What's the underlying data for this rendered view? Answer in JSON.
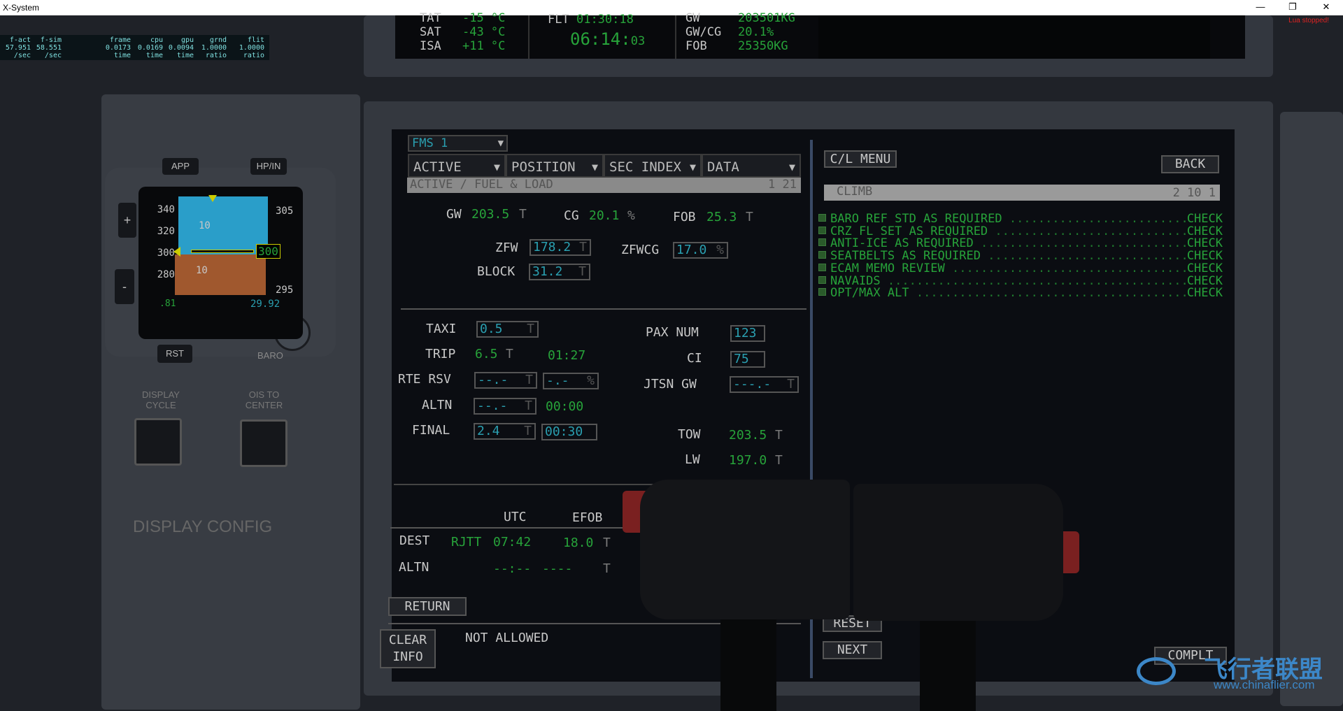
{
  "window": {
    "title": "X-System",
    "minimize": "—",
    "restore": "❐",
    "close": "✕",
    "lua_status": "Lua stopped!"
  },
  "stats": {
    "cols": [
      {
        "h": "f-act",
        "v": "57.951",
        "u": "/sec"
      },
      {
        "h": "f-sim",
        "v": "58.551",
        "u": "/sec"
      },
      {
        "h": "frame",
        "v": "0.0173",
        "u": "time"
      },
      {
        "h": "cpu",
        "v": "0.0169",
        "u": "time"
      },
      {
        "h": "gpu",
        "v": "0.0094",
        "u": "time"
      },
      {
        "h": "grnd",
        "v": "1.0000",
        "u": "ratio"
      },
      {
        "h": "flit",
        "v": "1.0000",
        "u": "ratio"
      }
    ]
  },
  "top_display": {
    "tat_label": "TAT",
    "tat_val": "-15 °C",
    "sat_label": "SAT",
    "sat_val": "-43 °C",
    "isa_label": "ISA",
    "isa_val": "+11 °C",
    "flt_label": "FLT",
    "flt_val": "01:30:18",
    "clock": "06:14",
    "clock_sec": "03",
    "gw_label": "GW",
    "gw_val": "203501KG",
    "gwcg_label": "GW/CG",
    "gwcg_val": "20.1%",
    "fob_label": "FOB",
    "fob_val": "25350KG"
  },
  "pfd": {
    "app": "APP",
    "hpin": "HP/IN",
    "rst": "RST",
    "baro": "BARO",
    "plus": "+",
    "minus": "-",
    "speeds": [
      "340",
      "320",
      "300",
      "280"
    ],
    "alts": [
      "305",
      "300",
      "295"
    ],
    "pitch": "10",
    "mach": ".81",
    "baro_set": "29.92",
    "display_cycle": "DISPLAY CYCLE",
    "ois_center": "OIS TO CENTER",
    "display_config": "DISPLAY CONFIG"
  },
  "fms": {
    "selector": "FMS 1",
    "tabs": [
      "ACTIVE",
      "POSITION",
      "SEC INDEX",
      "DATA"
    ],
    "header": "ACTIVE / FUEL & LOAD",
    "page": "1 21",
    "gw_label": "GW",
    "gw": "203.5",
    "cg_label": "CG",
    "cg": "20.1",
    "fob_label": "FOB",
    "fob": "25.3",
    "zfw_label": "ZFW",
    "zfw": "178.2",
    "zfwcg_label": "ZFWCG",
    "zfwcg": "17.0",
    "block_label": "BLOCK",
    "block": "31.2",
    "taxi_label": "TAXI",
    "taxi": "0.5",
    "trip_label": "TRIP",
    "trip": "6.5",
    "trip_time": "01:27",
    "rte_rsv_label": "RTE RSV",
    "rte_rsv": "--.-",
    "rte_rsv_pct": "-.-",
    "altn_label": "ALTN",
    "altn": "--.-",
    "altn_time": "00:00",
    "final_label": "FINAL",
    "final": "2.4",
    "final_time": "00:30",
    "pax_label": "PAX NUM",
    "pax": "123",
    "ci_label": "CI",
    "ci": "75",
    "jtsn_label": "JTSN GW",
    "jtsn": "---.-",
    "tow_label": "TOW",
    "tow": "203.5",
    "lw_label": "LW",
    "lw": "197.0",
    "utc_label": "UTC",
    "efob_label": "EFOB",
    "dest_label": "DEST",
    "dest": "RJTT",
    "dest_utc": "07:42",
    "dest_efob": "18.0",
    "altn2_label": "ALTN",
    "altn_utc": "--:--",
    "altn_efob": "----",
    "unit_t": "T",
    "unit_pct": "%",
    "return": "RETURN",
    "clear_info": "CLEAR INFO",
    "message": "NOT ALLOWED"
  },
  "checklist": {
    "menu": "C/L MENU",
    "back": "BACK",
    "title": "CLIMB",
    "page": "2 10 1",
    "items": [
      {
        "t": "BARO REF STD AS REQUIRED",
        "s": "CHECK"
      },
      {
        "t": "CRZ FL SET AS REQUIRED",
        "s": "CHECK"
      },
      {
        "t": "ANTI-ICE AS REQUIRED",
        "s": "CHECK"
      },
      {
        "t": "SEATBELTS AS REQUIRED",
        "s": "CHECK"
      },
      {
        "t": "ECAM MEMO REVIEW",
        "s": "CHECK"
      },
      {
        "t": "NAVAIDS",
        "s": "CHECK"
      },
      {
        "t": "OPT/MAX ALT",
        "s": "CHECK"
      }
    ],
    "reset": "RESET",
    "next": "NEXT",
    "complt": "COMPLT"
  },
  "watermark": {
    "cn": "飞行者联盟",
    "url": "www.chinaflier.com"
  },
  "colors": {
    "green": "#27a33a",
    "cyan": "#2a9fb0",
    "sky": "#2a9ec9",
    "ground": "#a0582e"
  }
}
